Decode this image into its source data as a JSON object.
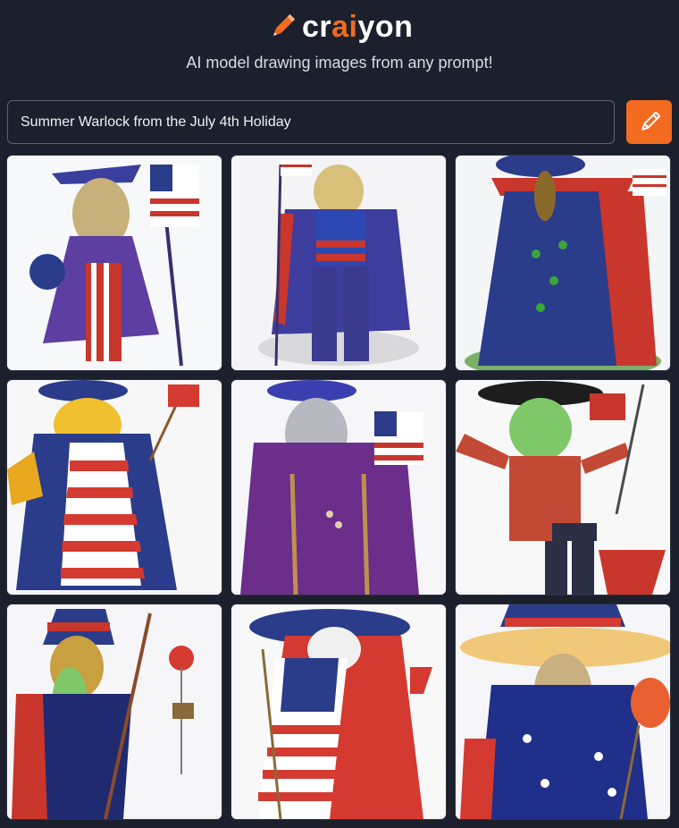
{
  "brand": {
    "name_prefix": "cr",
    "name_highlight": "ai",
    "name_suffix": "yon",
    "accent_color": "#f26b21",
    "logo_icon": "pencil-icon"
  },
  "tagline": "AI model drawing images from any prompt!",
  "prompt": {
    "value": "Summer Warlock from the July 4th Holiday",
    "placeholder": ""
  },
  "draw_button": {
    "icon": "pencil-icon"
  },
  "images": [
    {
      "description": "wizard-with-flag-1"
    },
    {
      "description": "wizard-with-flag-2"
    },
    {
      "description": "wizard-with-flag-3"
    },
    {
      "description": "wizard-with-flag-4"
    },
    {
      "description": "wizard-with-flag-5"
    },
    {
      "description": "wizard-with-flag-6"
    },
    {
      "description": "wizard-with-flag-7"
    },
    {
      "description": "wizard-with-flag-8"
    },
    {
      "description": "wizard-with-flag-9"
    }
  ]
}
